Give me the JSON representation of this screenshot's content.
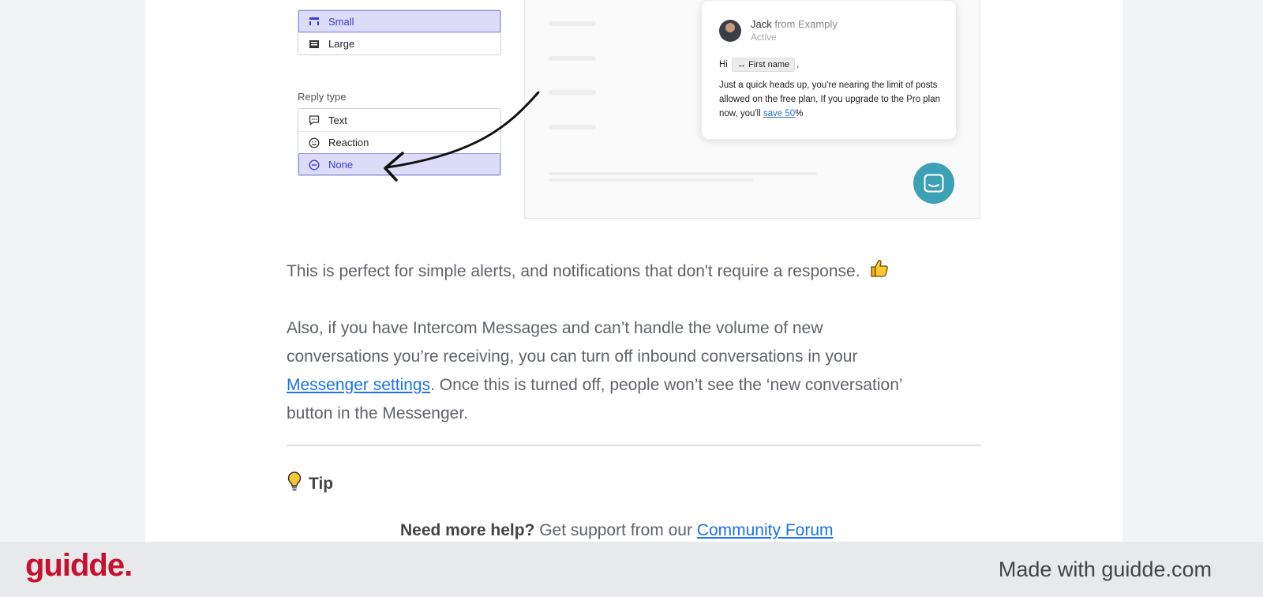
{
  "format_options": {
    "items": [
      {
        "label": "Small",
        "selected": true,
        "icon": "small-format-icon"
      },
      {
        "label": "Large",
        "selected": false,
        "icon": "large-format-icon"
      }
    ]
  },
  "reply_type": {
    "label": "Reply type",
    "items": [
      {
        "label": "Text",
        "selected": false,
        "icon": "chat-bubble-icon"
      },
      {
        "label": "Reaction",
        "selected": false,
        "icon": "smiley-icon"
      },
      {
        "label": "None",
        "selected": true,
        "icon": "minus-circle-icon"
      }
    ]
  },
  "message_preview": {
    "sender": "Jack",
    "from_text": "from Examply",
    "status": "Active",
    "greeting": "Hi",
    "chip": "First name",
    "comma": ",",
    "body": "Just a quick heads up, you're nearing the limit of posts allowed on the free plan, If you upgrade to the Pro plan now, you'll",
    "link": "save 50",
    "suffix": "%"
  },
  "article": {
    "para1": "This is perfect for simple alerts, and notifications that don't require a response.",
    "para2_line1": "Also, if you have Intercom Messages and can’t handle the volume of new",
    "para2_line2": "conversations you’re receiving, you can turn off inbound conversations in your",
    "para2_link": "Messenger settings",
    "para2_line3_rest": ". Once this is turned off, people won’t see the ‘new conversation’",
    "para2_line4": "button in the Messenger.",
    "tip_label": "Tip",
    "help_bold": "Need more help?",
    "help_text": " Get support from our ",
    "help_link": "Community Forum"
  },
  "footer": {
    "logo": "guidde.",
    "made_with": "Made with guidde.com"
  },
  "colors": {
    "logo": "#c8102e",
    "link": "#1a73e8",
    "selected_bg": "#dcdcf8",
    "launcher": "#3da1b5"
  }
}
